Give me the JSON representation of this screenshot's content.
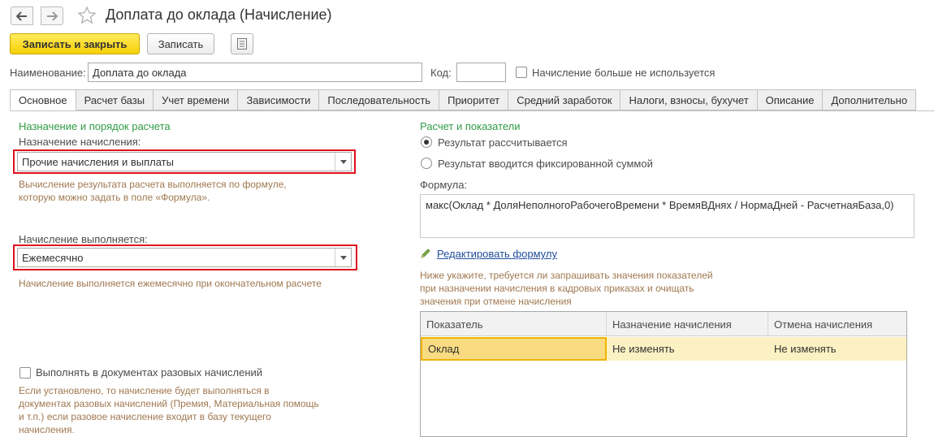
{
  "window": {
    "title": "Доплата до оклада (Начисление)"
  },
  "toolbar": {
    "save_close_label": "Записать и закрыть",
    "save_label": "Записать"
  },
  "header": {
    "name_label": "Наименование:",
    "name_value": "Доплата до оклада",
    "code_label": "Код:",
    "code_value": "",
    "not_used_label": "Начисление больше не используется",
    "not_used_checked": false
  },
  "tabs": [
    {
      "label": "Основное",
      "active": true
    },
    {
      "label": "Расчет базы"
    },
    {
      "label": "Учет времени"
    },
    {
      "label": "Зависимости"
    },
    {
      "label": "Последовательность"
    },
    {
      "label": "Приоритет"
    },
    {
      "label": "Средний заработок"
    },
    {
      "label": "Налоги, взносы, бухучет"
    },
    {
      "label": "Описание"
    },
    {
      "label": "Дополнительно"
    }
  ],
  "left": {
    "group_title": "Назначение и порядок расчета",
    "purpose_label": "Назначение начисления:",
    "purpose_value": "Прочие начисления и выплаты",
    "purpose_hint_1": "Вычисление результата расчета выполняется по формуле,",
    "purpose_hint_2": "которую можно задать в поле «Формула».",
    "schedule_label": "Начисление выполняется:",
    "schedule_value": "Ежемесячно",
    "schedule_hint": "Начисление выполняется ежемесячно при окончательном расчете",
    "one_time_label": "Выполнять в документах разовых начислений",
    "one_time_checked": false,
    "one_time_hint_1": "Если установлено, то начисление будет выполняться в",
    "one_time_hint_2": "документах разовых начислений (Премия, Материальная помощь",
    "one_time_hint_3": "и т.п.) если разовое начисление входит в базу текущего",
    "one_time_hint_4": "начисления."
  },
  "right": {
    "group_title": "Расчет и показатели",
    "radio_calculated": "Результат рассчитывается",
    "radio_fixed": "Результат вводится фиксированной суммой",
    "selected_radio": "calculated",
    "formula_label": "Формула:",
    "formula_value": "макс(Оклад * ДоляНеполногоРабочегоВремени * ВремяВДнях / НормаДней - РасчетнаяБаза,0)",
    "edit_formula_link": "Редактировать формулу",
    "indicators_hint_1": "Ниже укажите, требуется ли запрашивать значения показателей",
    "indicators_hint_2": "при назначении начисления в кадровых приказах и очищать",
    "indicators_hint_3": "значения при отмене начисления"
  },
  "indicators_table": {
    "columns": [
      "Показатель",
      "Назначение начисления",
      "Отмена начисления"
    ],
    "rows": [
      [
        "Оклад",
        "Не изменять",
        "Не изменять"
      ]
    ]
  },
  "colors": {
    "primary_button": "#f6cf05",
    "group_title": "#2f9b45",
    "hint_text": "#a07850",
    "highlight_frame": "#e0101e",
    "link": "#1f4e9c",
    "selected_row": "#fbf1c2"
  },
  "icons": [
    "back-arrow-icon",
    "forward-arrow-icon",
    "favorite-star-icon",
    "more-menu-icon",
    "dropdown-arrow-icon",
    "pencil-icon"
  ]
}
